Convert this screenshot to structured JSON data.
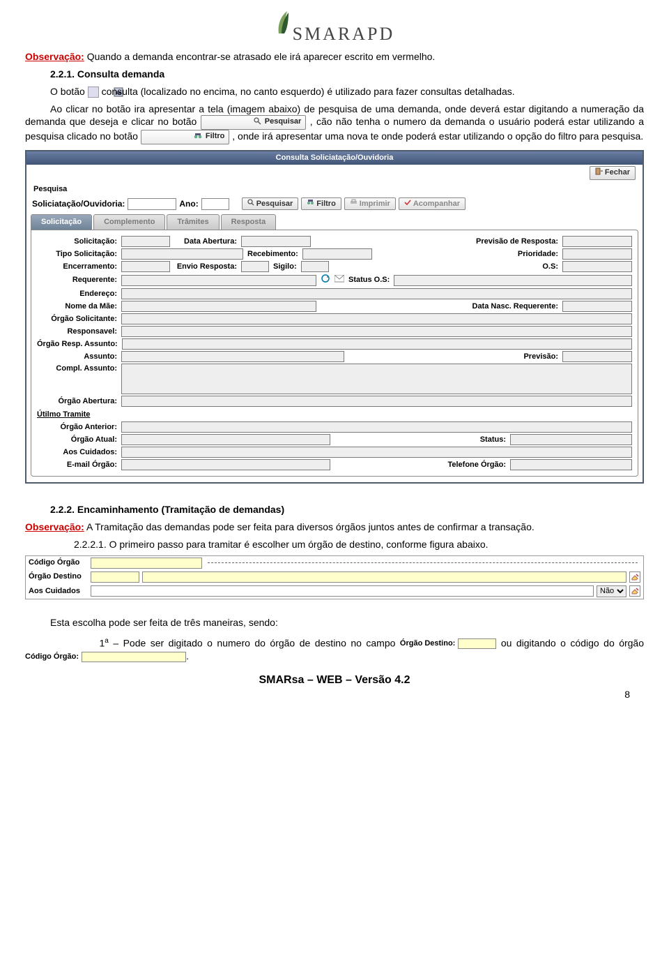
{
  "header": {
    "brand": "SMARAPD"
  },
  "text": {
    "obs1_label": "Observação:",
    "obs1_text": " Quando a demanda encontrar-se atrasado ele irá aparecer escrito em vermelho.",
    "s221_num": "2.2.1.",
    "s221_title": " Consulta demanda",
    "p221a_a": "O botão ",
    "p221a_b": " consulta (localizado no encima, no canto esquerdo) é utilizado para fazer consultas detalhadas.",
    "p221b_a": "Ao clicar no botão ira apresentar a tela (imagem abaixo) de pesquisa de uma demanda, onde deverá estar digitando a numeração da demanda que deseja e clicar no botão ",
    "p221b_b": ", cão não tenha o numero da demanda o usuário poderá estar utilizando a pesquisa clicado no botão ",
    "p221b_c": ", onde irá apresentar uma nova te onde poderá estar utilizando o opção do filtro para pesquisa.",
    "btn_pesquisar": "Pesquisar",
    "btn_filtro": "Filtro",
    "s222_num": "2.2.2.",
    "s222_title": " Encaminhamento (Tramitação de demandas)",
    "obs2_label": "Observação:",
    "obs2_text": " A Tramitação das demandas pode ser feita para diversos órgãos juntos antes de confirmar a transação.",
    "s2221_num": "2.2.2.1.",
    "s2221_text": " O primeiro passo para tramitar é escolher um órgão de destino, conforme figura abaixo.",
    "p_end_a": "Esta escolha pode ser feita de três maneiras, sendo:",
    "p_end_b_a": "1",
    "p_end_b_sup": "a",
    "p_end_b_b": " – Pode ser digitado o numero do órgão de destino no campo ",
    "p_end_b_c": " ou digitando o código do órgão ",
    "lbl_orgao_destino": "Órgão Destino:",
    "lbl_codigo_orgao": "Código Órgão:"
  },
  "form": {
    "title": "Consulta Soliciatação/Ouvidoria",
    "close": "Fechar",
    "pesquisa_lbl": "Pesquisa",
    "main_lbl": "Soliciatação/Ouvidoria:",
    "ano_lbl": "Ano:",
    "btn_pesq": "Pesquisar",
    "btn_filtro": "Filtro",
    "btn_imp": "Imprimir",
    "btn_acomp": "Acompanhar",
    "tabs": [
      "Solicitação",
      "Complemento",
      "Trâmites",
      "Resposta"
    ],
    "fields": {
      "solicitacao": "Solicitação:",
      "data_abertura": "Data Abertura:",
      "previsao_resposta": "Previsão de Resposta:",
      "tipo_solicitacao": "Tipo Solicitação:",
      "recebimento": "Recebimento:",
      "prioridade": "Prioridade:",
      "encerramento": "Encerramento:",
      "envio_resposta": "Envio Resposta:",
      "sigilo": "Sigilo:",
      "os": "O.S:",
      "requerente": "Requerente:",
      "status_os": "Status O.S:",
      "endereco": "Endereço:",
      "nome_mae": "Nome da Mãe:",
      "data_nasc": "Data Nasc. Requerente:",
      "orgao_solic": "Órgão Solicitante:",
      "responsavel": "Responsavel:",
      "orgao_resp_assunto": "Órgão Resp. Assunto:",
      "assunto": "Assunto:",
      "previsao": "Previsão:",
      "compl_assunto": "Compl. Assunto:",
      "orgao_abertura": "Órgão Abertura:",
      "ultimo_tramite": "Útilmo Tramite",
      "orgao_anterior": "Órgão Anterior:",
      "orgao_atual": "Órgão Atual:",
      "status": "Status:",
      "aos_cuidados": "Aos Cuidados:",
      "email_orgao": "E-mail Órgão:",
      "telefone_orgao": "Telefone Órgão:"
    }
  },
  "enc": {
    "codigo_orgao": "Código Órgão",
    "orgao_destino": "Órgão Destino",
    "aos_cuidados": "Aos Cuidados",
    "nao": "Não"
  },
  "footer": {
    "line": "SMARsa – WEB – Versão 4.2",
    "page": "8"
  }
}
